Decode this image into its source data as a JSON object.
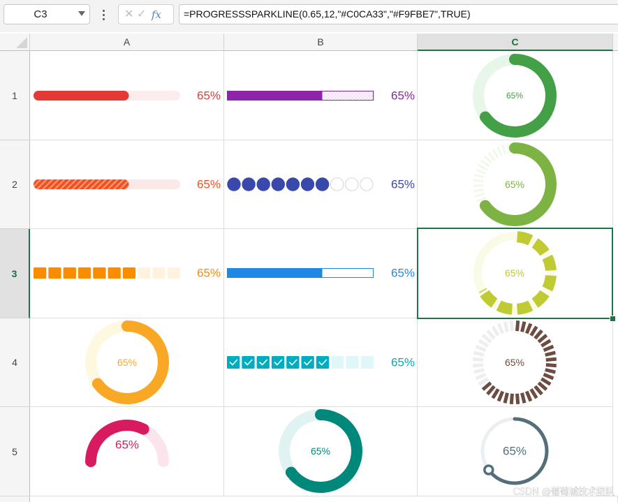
{
  "name_box": {
    "value": "C3"
  },
  "formula_bar": {
    "cancel_glyph": "✕",
    "enter_glyph": "✓",
    "fx_label": "fx",
    "formula": "=PROGRESSSPARKLINE(0.65,12,\"#C0CA33\",\"#F9FBE7\",TRUE)"
  },
  "columns": [
    "A",
    "B",
    "C"
  ],
  "rows": [
    "1",
    "2",
    "3",
    "4",
    "5"
  ],
  "selected_cell": {
    "column": "C",
    "row": "3"
  },
  "cells": {
    "A1": {
      "type": "bar-rounded",
      "value": 0.65,
      "label": "65%",
      "color": "#E53935",
      "track": "#FDECEC"
    },
    "B1": {
      "type": "bar-hatched-track",
      "value": 0.65,
      "label": "65%",
      "color": "#8E24AA",
      "track": "#EFD9F5"
    },
    "C1": {
      "type": "ring",
      "value": 0.65,
      "label": "65%",
      "color": "#43A047",
      "track": "#E8F5E9"
    },
    "A2": {
      "type": "bar-striped",
      "value": 0.65,
      "label": "65%",
      "color": "#F4511E",
      "track": "#FBE9E7"
    },
    "B2": {
      "type": "dots",
      "value": 0.65,
      "count": 10,
      "label": "65%",
      "color": "#3949AB",
      "track": "#D6D6D6"
    },
    "C2": {
      "type": "ring-ticks-track",
      "value": 0.65,
      "label": "65%",
      "color": "#7CB342",
      "track": "#F1F8E9"
    },
    "A3": {
      "type": "blocks",
      "value": 0.65,
      "count": 10,
      "label": "65%",
      "color": "#FB8C00",
      "track": "#FFF3E0"
    },
    "B3": {
      "type": "bar-outline",
      "value": 0.65,
      "label": "65%",
      "color": "#1E88E5",
      "track": "#E3F2FD"
    },
    "C3": {
      "type": "ring-segments",
      "value": 0.65,
      "segments": 12,
      "label": "65%",
      "color": "#C0CA33",
      "track": "#F9FBE7"
    },
    "A4": {
      "type": "ring",
      "value": 0.65,
      "label": "65%",
      "color": "#F9A825",
      "track": "#FFF8E1"
    },
    "B4": {
      "type": "checks",
      "value": 0.65,
      "count": 10,
      "label": "65%",
      "color": "#00ACC1",
      "track": "#E0F7FA"
    },
    "C4": {
      "type": "ring-ticks",
      "value": 0.65,
      "segments": 40,
      "label": "65%",
      "color": "#6D4C41",
      "track": "#EEEEEE"
    },
    "A5": {
      "type": "semi-gauge",
      "value": 0.65,
      "label": "65%",
      "color": "#D81B60",
      "track": "#FCE4EC"
    },
    "B5": {
      "type": "ring",
      "value": 0.65,
      "label": "65%",
      "color": "#00897B",
      "track": "#E0F2F1"
    },
    "C5": {
      "type": "ring-thin-knob",
      "value": 0.65,
      "label": "65%",
      "color": "#546E7A",
      "track": "#ECEFF1"
    }
  },
  "watermark": "CSDN @葡萄城技术团队"
}
